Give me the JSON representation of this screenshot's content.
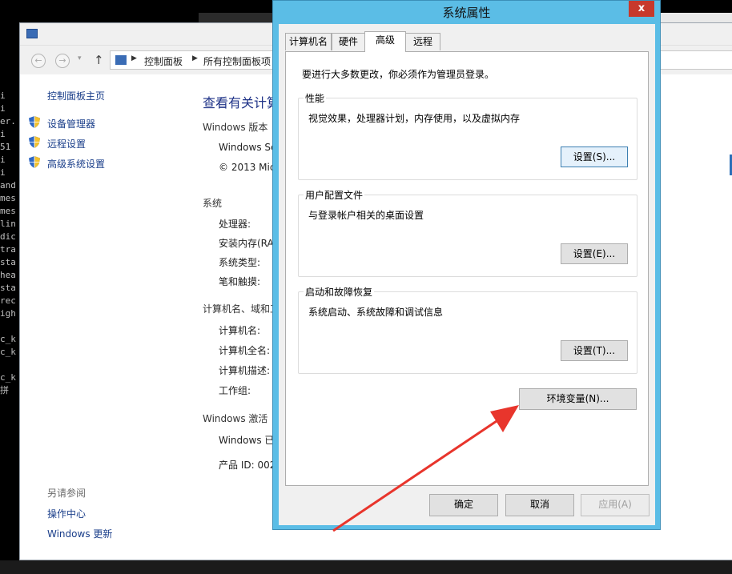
{
  "terminal": {
    "lines": [
      "i",
      "i",
      "er.",
      "i",
      "51",
      "i",
      "i",
      "and",
      "mes",
      "mes",
      "lin",
      "dic",
      "tra",
      "sta",
      "hea",
      "sta",
      "rec",
      "igh",
      "",
      "c_k",
      "c_k",
      "",
      "c_k",
      "拼"
    ]
  },
  "control_panel": {
    "breadcrumb": [
      "控制面板",
      "所有控制面板项"
    ],
    "left_nav": {
      "home": "控制面板主页",
      "links": [
        "设备管理器",
        "远程设置",
        "高级系统设置"
      ],
      "see_also_label": "另请参阅",
      "see_also_links": [
        "操作中心",
        "Windows 更新"
      ]
    },
    "main": {
      "heading": "查看有关计算",
      "edition_section": "Windows 版本",
      "edition_rows": [
        "Windows Se",
        "© 2013 Mic"
      ],
      "system_section": "系统",
      "system_rows": [
        "处理器:",
        "安装内存(RA",
        "系统类型:",
        "笔和触摸:"
      ],
      "computer_section": "计算机名、域和工",
      "computer_rows": [
        "计算机名:",
        "计算机全名:",
        "计算机描述:",
        "工作组:"
      ],
      "activation_section": "Windows 激活",
      "activation_rows": [
        "Windows 已",
        "产品 ID: 002"
      ]
    }
  },
  "dialog": {
    "title": "系统属性",
    "close_label": "x",
    "tabs": [
      "计算机名",
      "硬件",
      "高级",
      "远程"
    ],
    "active_tab": "高级",
    "notice": "要进行大多数更改，你必须作为管理员登录。",
    "groups": [
      {
        "legend": "性能",
        "desc": "视觉效果，处理器计划，内存使用，以及虚拟内存",
        "button": "设置(S)..."
      },
      {
        "legend": "用户配置文件",
        "desc": "与登录帐户相关的桌面设置",
        "button": "设置(E)..."
      },
      {
        "legend": "启动和故障恢复",
        "desc": "系统启动、系统故障和调试信息",
        "button": "设置(T)..."
      }
    ],
    "env_button": "环境变量(N)...",
    "ok_button": "确定",
    "cancel_button": "取消",
    "apply_button": "应用(A)"
  },
  "colors": {
    "dialog_frame": "#5bbde6",
    "close_button": "#c7392c",
    "annotation_arrow": "#e8352c",
    "link_blue": "#1a3e8a"
  }
}
